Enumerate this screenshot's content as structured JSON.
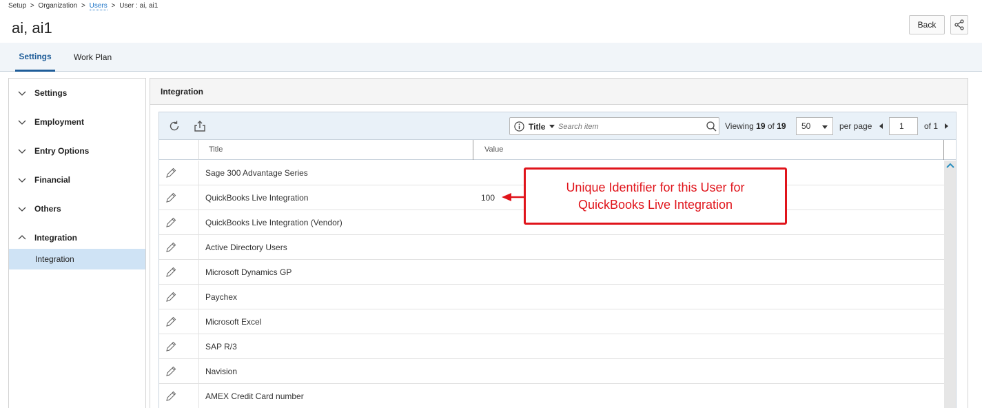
{
  "breadcrumb": {
    "setup": "Setup",
    "organization": "Organization",
    "users": "Users",
    "current": "User : ai, ai1",
    "separator": ">"
  },
  "page_title": "ai, ai1",
  "header_buttons": {
    "back": "Back",
    "share_icon": "share-icon"
  },
  "tabs": [
    {
      "label": "Settings",
      "active": true
    },
    {
      "label": "Work Plan",
      "active": false
    }
  ],
  "sidebar": {
    "groups": [
      {
        "label": "Settings",
        "expanded": false
      },
      {
        "label": "Employment",
        "expanded": false
      },
      {
        "label": "Entry Options",
        "expanded": false
      },
      {
        "label": "Financial",
        "expanded": false
      },
      {
        "label": "Others",
        "expanded": false
      },
      {
        "label": "Integration",
        "expanded": true
      }
    ],
    "selected_item": "Integration"
  },
  "panel": {
    "title": "Integration"
  },
  "toolbar": {
    "search_field": "Title",
    "search_placeholder": "Search item",
    "viewing_label": "Viewing",
    "viewing_count": "19",
    "of_label": "of",
    "viewing_total": "19",
    "per_page_value": "50",
    "per_page_label": "per page",
    "page_number": "1",
    "page_of": "of 1"
  },
  "columns": {
    "title": "Title",
    "value": "Value"
  },
  "rows": [
    {
      "title": "Sage 300 Advantage Series",
      "value": ""
    },
    {
      "title": "QuickBooks Live Integration",
      "value": "100"
    },
    {
      "title": "QuickBooks Live Integration (Vendor)",
      "value": ""
    },
    {
      "title": "Active Directory Users",
      "value": ""
    },
    {
      "title": "Microsoft Dynamics GP",
      "value": ""
    },
    {
      "title": "Paychex",
      "value": ""
    },
    {
      "title": "Microsoft Excel",
      "value": ""
    },
    {
      "title": "SAP R/3",
      "value": ""
    },
    {
      "title": "Navision",
      "value": ""
    },
    {
      "title": "AMEX Credit Card number",
      "value": ""
    }
  ],
  "annotation": {
    "line1": "Unique Identifier for this User for",
    "line2": "QuickBooks Live Integration",
    "color": "#e0141b"
  },
  "colors": {
    "accent": "#1f5d99",
    "link": "#1a73c7",
    "selected_bg": "#cfe3f5"
  }
}
